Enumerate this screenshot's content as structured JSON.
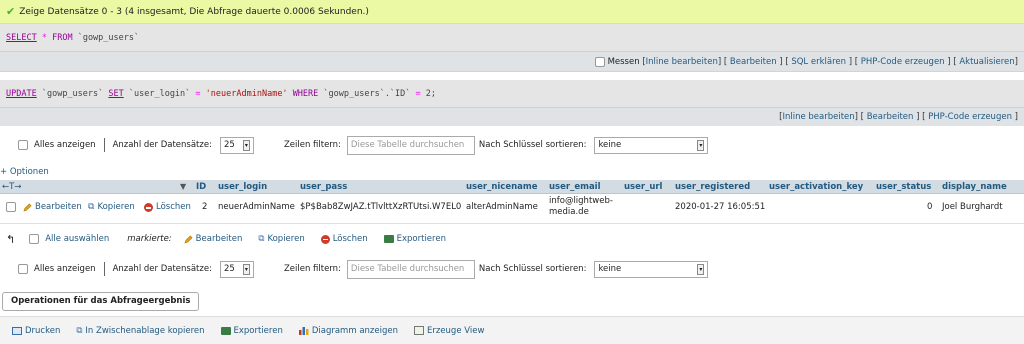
{
  "success": {
    "message": "Zeige Datensätze 0 - 3 (4 insgesamt, Die Abfrage dauerte 0.0006 Sekunden.)"
  },
  "query1": {
    "kw1": "SELECT",
    "star": "*",
    "kw2": "FROM",
    "table": "`gowp_users`"
  },
  "toolbar1": {
    "messen": "Messen",
    "links": [
      "Inline bearbeiten",
      "Bearbeiten",
      "SQL erklären",
      "PHP-Code erzeugen",
      "Aktualisieren"
    ]
  },
  "query2": {
    "kw1": "UPDATE",
    "table": "`gowp_users`",
    "kw2": "SET",
    "col": "`user_login`",
    "eq": "=",
    "val": "'neuerAdminName'",
    "kw3": "WHERE",
    "qual": "`gowp_users`.`ID`",
    "eq2": "=",
    "num": "2;"
  },
  "toolbar2": {
    "links": [
      "Inline bearbeiten",
      "Bearbeiten",
      "PHP-Code erzeugen"
    ]
  },
  "nav": {
    "show_all": "Alles anzeigen",
    "count_label": "Anzahl der Datensätze:",
    "count_value": "25",
    "filter_label": "Zeilen filtern:",
    "filter_placeholder": "Diese Tabelle durchsuchen",
    "sort_label": "Nach Schlüssel sortieren:",
    "sort_value": "keine"
  },
  "options": {
    "label": "+ Optionen",
    "arrows": "←T→"
  },
  "table": {
    "columns": [
      "ID",
      "user_login",
      "user_pass",
      "user_nicename",
      "user_email",
      "user_url",
      "user_registered",
      "user_activation_key",
      "user_status",
      "display_name"
    ],
    "row": {
      "edit": "Bearbeiten",
      "copy": "Kopieren",
      "delete": "Löschen",
      "ID": "2",
      "user_login": "neuerAdminName",
      "user_pass": "$P$Bab8ZwJAZ.tTlvltt­XzRTUtsi.W7EL0",
      "user_nicename": "alterAdminName",
      "user_email_1": "info@lightweb-",
      "user_email_2": "media.de",
      "user_url": "",
      "user_registered": "2020-01-27 16:05:51",
      "user_activation_key": "",
      "user_status": "0",
      "display_name": "Joel Burghardt"
    }
  },
  "bulk": {
    "select_all": "Alle auswählen",
    "marked": "markierte:",
    "edit": "Bearbeiten",
    "copy": "Kopieren",
    "delete": "Löschen",
    "export": "Exportieren"
  },
  "ops": {
    "title": "Operationen für das Abfrageergebnis",
    "print": "Drucken",
    "clipboard": "In Zwischenablage kopieren",
    "export": "Exportieren",
    "chart": "Diagramm anzeigen",
    "view": "Erzeuge View"
  }
}
